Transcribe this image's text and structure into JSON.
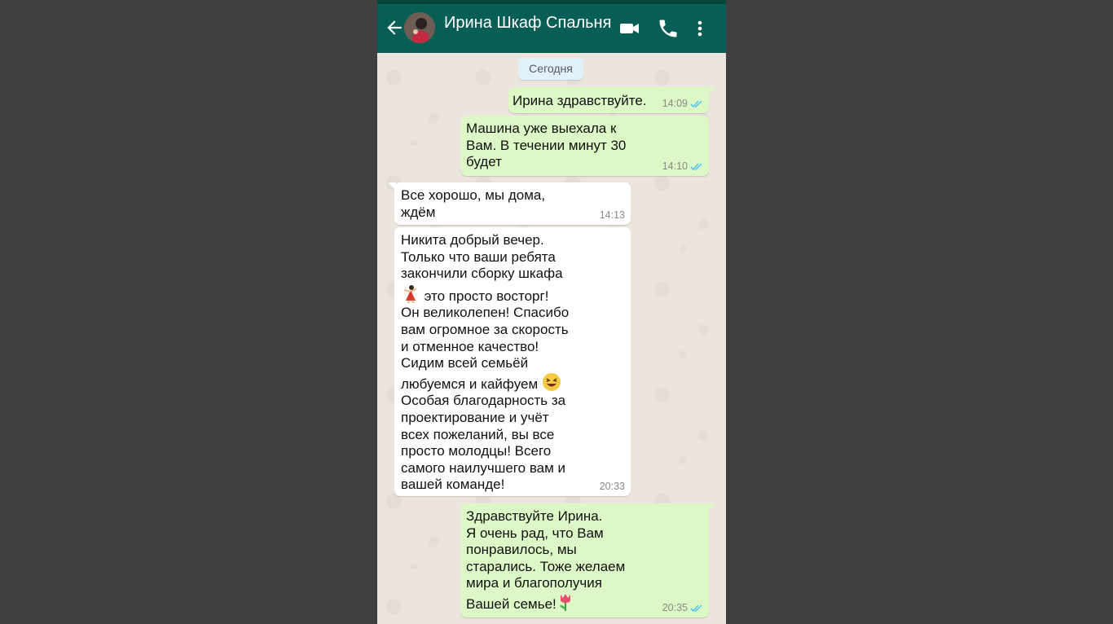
{
  "header": {
    "contact_name": "Ирина Шкаф Спальня"
  },
  "chat": {
    "date_label": "Сегодня",
    "messages": [
      {
        "direction": "out",
        "text": "Ирина здравствуйте.",
        "time": "14:09",
        "status": "read"
      },
      {
        "direction": "out",
        "text": "Машина уже выехала к\nВам. В течении минут 30\nбудет",
        "time": "14:10",
        "status": "read"
      },
      {
        "direction": "in",
        "text": "Все хорошо, мы дома,\nждём",
        "time": "14:13"
      },
      {
        "direction": "in",
        "text_1": "Никита добрый вечер.\nТолько что ваши ребята\nзакончили сборку шкафа",
        "emoji_1": "dancer-emoji",
        "text_2": "это просто восторг!\nОн великолепен! Спасибо\nвам огромное за скорость\nи отменное качество!\nСидим всей семьёй\nлюбуемся и кайфуем",
        "emoji_2": "laughing-emoji",
        "text_3": "Особая благодарность за\nпроектирование и учёт\nвсех пожеланий, вы все\nпросто молодцы! Всего\nсамого наилучшего вам и\nвашей команде!",
        "time": "20:33"
      },
      {
        "direction": "out",
        "text": "Здравствуйте Ирина.\nЯ очень рад, что Вам\nпонравилось, мы\nстарались. Тоже желаем\nмира и благополучия\nВашей семье!",
        "emoji": "tulip-emoji",
        "time": "20:35",
        "status": "read"
      }
    ]
  },
  "colors": {
    "header": "#075e54",
    "outgoing_bubble": "#dcf8c6",
    "incoming_bubble": "#ffffff",
    "chat_background": "#ece5dd",
    "read_ticks": "#4fc3f7"
  }
}
